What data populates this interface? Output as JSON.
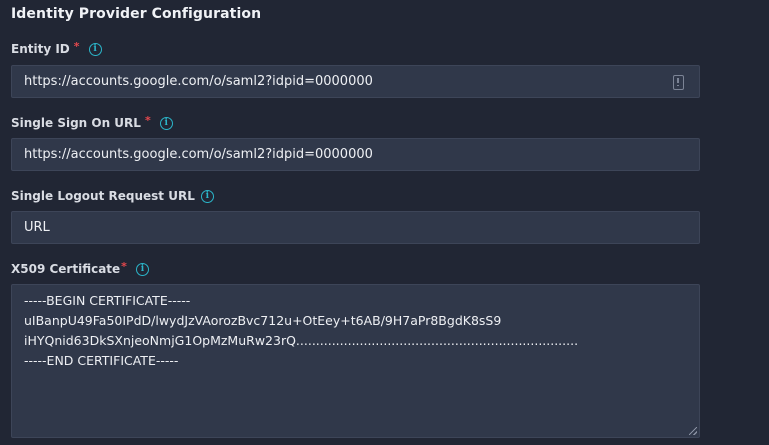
{
  "section": {
    "title": "Identity Provider Configuration"
  },
  "fields": {
    "entity_id": {
      "label": "Entity ID",
      "required_marker": "*",
      "info_icon": "info-icon",
      "value": "https://accounts.google.com/o/saml2?idpid=0000000",
      "trailing_icon": "clipboard-alert-icon"
    },
    "sso_url": {
      "label": "Single Sign On URL",
      "required_marker": "*",
      "info_icon": "info-icon",
      "value": "https://accounts.google.com/o/saml2?idpid=0000000"
    },
    "slo_url": {
      "label": "Single Logout Request URL",
      "info_icon": "info-icon",
      "value": "URL"
    },
    "certificate": {
      "label": "X509 Certificate",
      "required_marker": "*",
      "info_icon": "info-icon",
      "lines": [
        "-----BEGIN CERTIFICATE-----",
        "uIBanpU49Fa50IPdD/lwydJzVAorozBvc712u+OtEey+t6AB/9H7aPr8BgdK8sS9",
        "iHYQnid63DkSXnjeoNmjG1OpMzMuRw23rQ.......................................................................",
        "-----END CERTIFICATE-----"
      ]
    }
  },
  "colors": {
    "background": "#212634",
    "input_background": "#30384a",
    "info_accent": "#2bb5c9",
    "required": "#e5484d"
  }
}
